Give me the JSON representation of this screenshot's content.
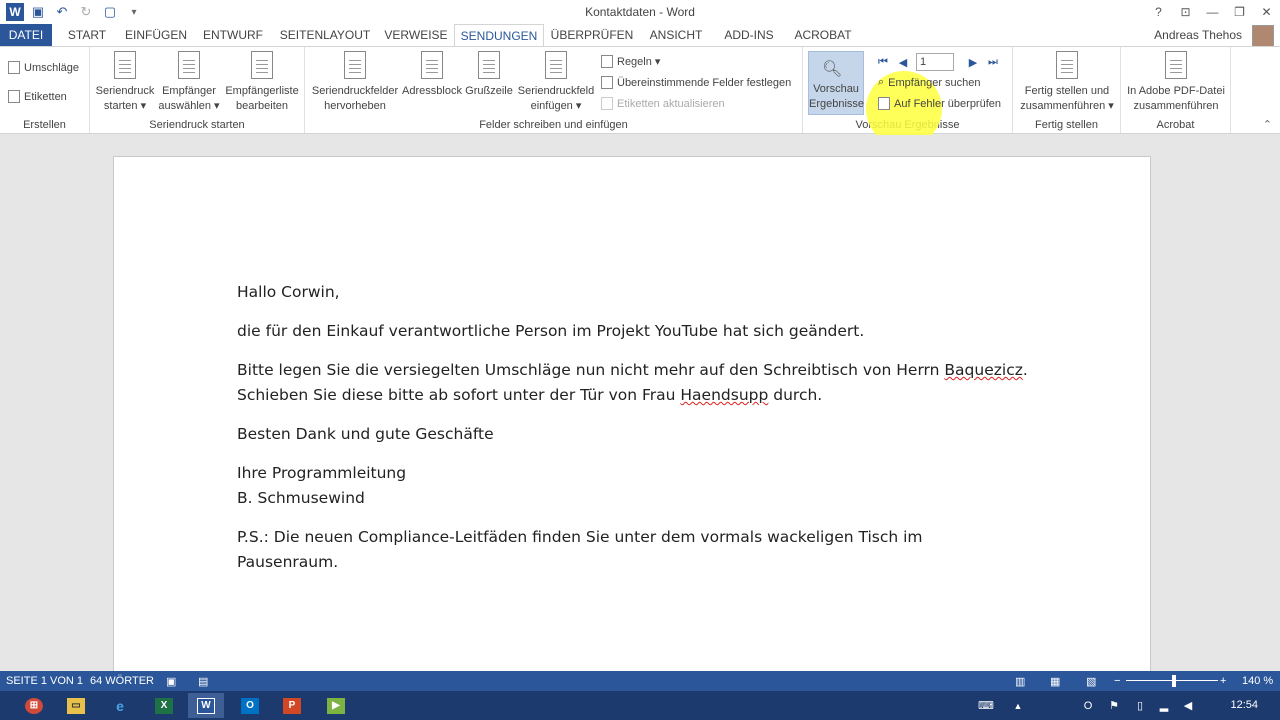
{
  "window": {
    "title": "Kontaktdaten - Word",
    "help": "?",
    "minimize": "—",
    "restore": "❐",
    "close": "✕",
    "options": "⊡"
  },
  "tabs": [
    {
      "label": "DATEI"
    },
    {
      "label": "START"
    },
    {
      "label": "EINFÜGEN"
    },
    {
      "label": "ENTWURF"
    },
    {
      "label": "SEITENLAYOUT"
    },
    {
      "label": "VERWEISE"
    },
    {
      "label": "SENDUNGEN"
    },
    {
      "label": "ÜBERPRÜFEN"
    },
    {
      "label": "ANSICHT"
    },
    {
      "label": "ADD-INS"
    },
    {
      "label": "ACROBAT"
    }
  ],
  "user": {
    "name": "Andreas Thehos"
  },
  "ribbon": {
    "erstellen": {
      "label": "Erstellen",
      "umschlaege": "Umschläge",
      "etiketten": "Etiketten"
    },
    "seriendruck": {
      "label": "Seriendruck starten",
      "start1": "Seriendruck",
      "start2": "starten ▾",
      "empf1": "Empfänger",
      "empf2": "auswählen ▾",
      "liste1": "Empfängerliste",
      "liste2": "bearbeiten"
    },
    "felder": {
      "label": "Felder schreiben und einfügen",
      "hervor1": "Seriendruckfelder",
      "hervor2": "hervorheben",
      "adressblock": "Adressblock",
      "grusszeile": "Grußzeile",
      "feld1": "Seriendruckfeld",
      "feld2": "einfügen ▾",
      "regeln": "Regeln ▾",
      "felder_festlegen": "Übereinstimmende Felder festlegen",
      "etiketten_akt": "Etiketten aktualisieren"
    },
    "vorschau": {
      "label": "Vorschau Ergebnisse",
      "btn1": "Vorschau",
      "btn2": "Ergebnisse",
      "record": "1",
      "suchen": "Empfänger suchen",
      "fehler": "Auf Fehler überprüfen"
    },
    "fertig": {
      "label": "Fertig stellen",
      "btn1": "Fertig stellen und",
      "btn2": "zusammenführen ▾"
    },
    "acrobat": {
      "label": "Acrobat",
      "btn1": "In Adobe PDF-Datei",
      "btn2": "zusammenführen"
    }
  },
  "document": {
    "greeting": "Hallo Corwin,",
    "p1": "die für den Einkauf verantwortliche Person im Projekt YouTube hat sich geändert.",
    "p2a_pre": "Bitte legen Sie die versiegelten Umschläge nun nicht mehr auf den Schreibtisch von Herrn ",
    "p2a_err": "Baquezicz",
    "p2a_post": ".",
    "p2b_pre": "Schieben Sie diese bitte ab sofort unter der Tür von Frau ",
    "p2b_err": "Haendsupp",
    "p2b_post": " durch.",
    "p3": "Besten Dank und gute Geschäfte",
    "p4a": "Ihre Programmleitung",
    "p4b": "B. Schmusewind",
    "p5a": "P.S.: Die neuen Compliance-Leitfäden finden Sie unter dem vormals wackeligen Tisch im",
    "p5b": "Pausenraum."
  },
  "status": {
    "page": "SEITE 1 VON 1",
    "words": "64 WÖRTER",
    "zoom": "140 %"
  },
  "taskbar": {
    "clock": "12:54"
  },
  "colors": {
    "accent": "#2b579a",
    "highlight": "#ffff3c"
  }
}
